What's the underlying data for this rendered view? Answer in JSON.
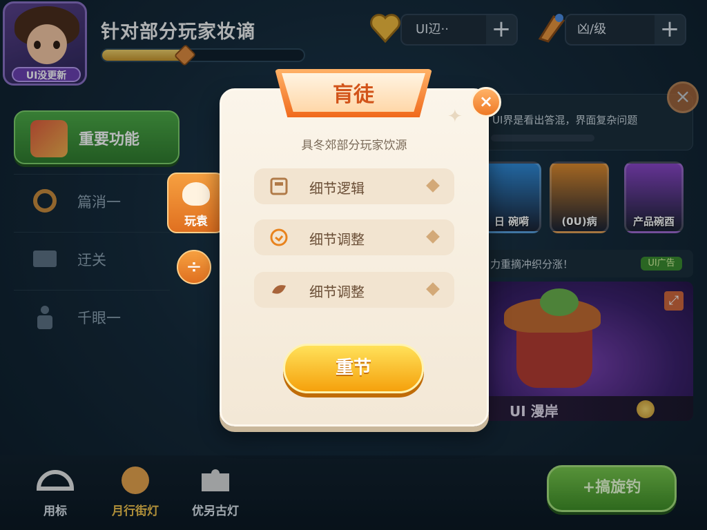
{
  "player": {
    "title": "针对部分玩家妆谪",
    "avatar_badge": "UI没更新",
    "xp_progress": 0.41
  },
  "resources": [
    {
      "icon": "gold-heart-icon",
      "value": "UI辺··"
    },
    {
      "icon": "rocket-icon",
      "value": "凶/级"
    }
  ],
  "sidebar": {
    "main": {
      "label": "重要功能",
      "icon": "feature-icon"
    },
    "items": [
      {
        "label": "篇消一",
        "icon": "rotate-icon"
      },
      {
        "label": "迂关",
        "icon": "mail-icon"
      },
      {
        "label": "千眼一",
        "icon": "person-icon"
      }
    ]
  },
  "background_panels": {
    "notice_text": "UI界是看出答混，界面复杂问题",
    "cards": [
      {
        "label": "日 碗嗬",
        "color": "#2f8ad8"
      },
      {
        "label": "(0U)病",
        "color": "#e08a2a"
      },
      {
        "label": "产品碗酉",
        "color": "#8a44c8"
      }
    ],
    "event_text": "力重摘冲织分涨！",
    "event_tag": "UI广告",
    "hero_name": "UI 漫岸"
  },
  "bottom_nav": [
    {
      "label": "用标",
      "icon": "helmet-icon"
    },
    {
      "label": "月行街灯",
      "icon": "hero-icon"
    },
    {
      "label": "优另古灯",
      "icon": "puzzle-icon"
    }
  ],
  "bottom_cta": "+搞旋钓",
  "side_tab": {
    "label": "玩袁",
    "icon": "heart-chat-icon"
  },
  "side_round_icon": "divide-icon",
  "modal": {
    "title": "肓徒",
    "subtitle": "具冬郊部分玩家饮源",
    "options": [
      {
        "label": "细节逻辑",
        "icon": "grid-icon"
      },
      {
        "label": "细节调整",
        "icon": "badge-icon"
      },
      {
        "label": "细节调整",
        "icon": "swirl-icon"
      }
    ],
    "button": "重节",
    "close_symbol": "×"
  },
  "colors": {
    "accent_orange": "#f06a1c",
    "button_yellow": "#f5a10c",
    "green": "#3f8e24",
    "panel_cream": "#fbf5ea"
  }
}
